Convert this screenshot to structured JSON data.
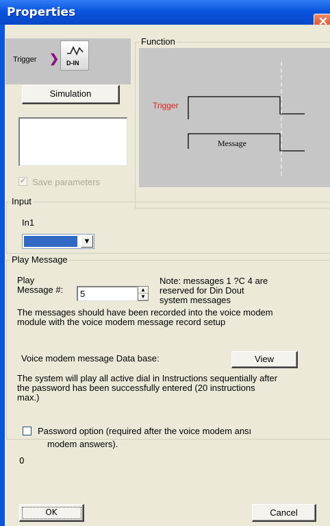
{
  "window": {
    "title": "Properties",
    "close_glyph": "✕",
    "colors": {
      "titlebar": "#0a55de",
      "client": "#ece9d8",
      "close": "#d9431e",
      "trigger_text": "#e02020"
    }
  },
  "trigger_block": {
    "label": "Trigger",
    "arrow_glyph": "❯",
    "block_label": "D-IN"
  },
  "simulation_button": "Simulation",
  "save_parameters": {
    "label": "Save parameters",
    "checked": true,
    "disabled": true,
    "check_glyph": "✔"
  },
  "function_group": {
    "legend": "Function",
    "trigger_label": "Trigger",
    "message_label": "Message"
  },
  "input_group": {
    "legend": "Input",
    "input_name": "In1",
    "combo_arrow": "▼"
  },
  "play_message_group": {
    "legend": "Play Message",
    "play_label_line1": "Play",
    "play_label_line2": "Message #:",
    "message_number": "5",
    "spin_up": "▲",
    "spin_down": "▼",
    "note_line1": "Note: messages 1 ?C 4 are",
    "note_line2": "reserved for Din  Dout",
    "note_line3": "system messages",
    "recorded_line1": "The messages should have been recorded into the voice modem",
    "recorded_line2": "module with the voice modem message record setup",
    "db_label": "Voice modem message Data base:",
    "view_button": "View",
    "system_line1": "The system will play all active dial in Instructions sequentially after",
    "system_line2": "the password has been successfully entered (20 instructions",
    "system_line3": "max.)"
  },
  "password_option": {
    "line1": "Password option (required after the voice modem ansı",
    "line2": "modem answers).",
    "checked": false,
    "value": "0"
  },
  "buttons": {
    "ok": "OK",
    "cancel": "Cancel"
  }
}
